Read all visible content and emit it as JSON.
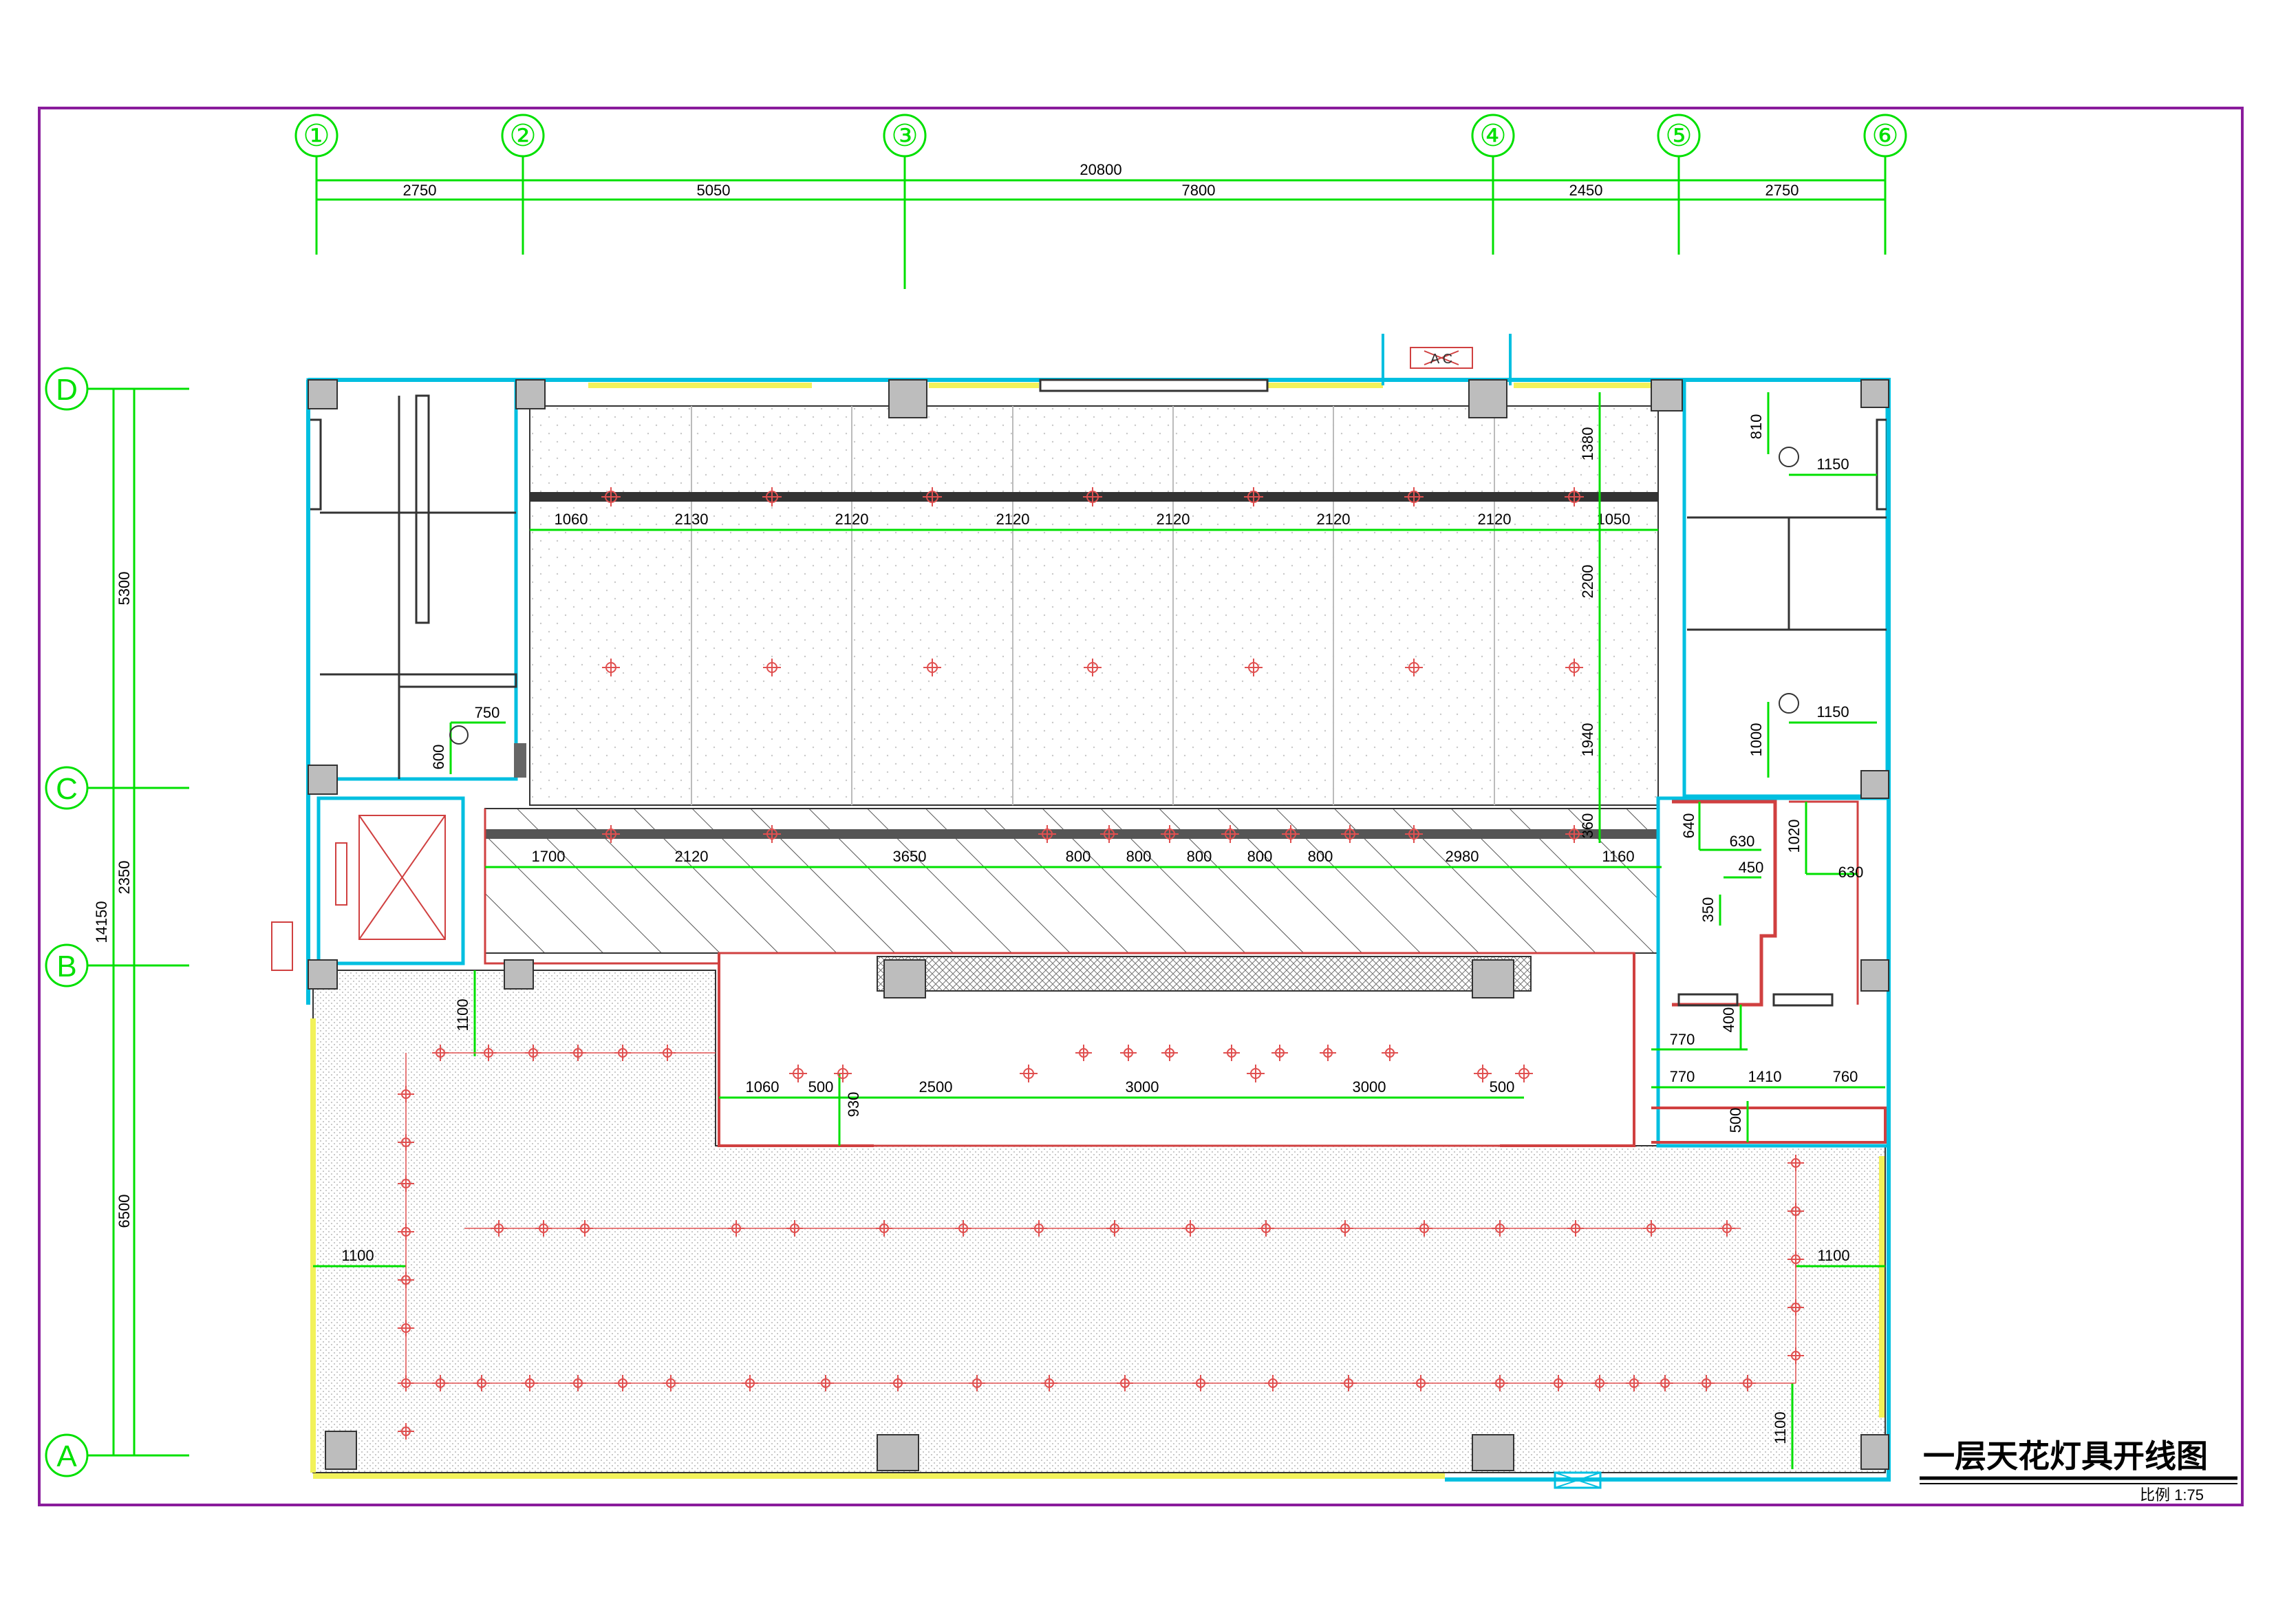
{
  "title": "一层天花灯具开线图",
  "scale": "比例 1:75",
  "colors": {
    "frame": "#8a1c9c",
    "dim": "#00e000",
    "wall": "#00bfe0",
    "fixture": "#e05050",
    "column": "#bdbdbd",
    "window": "#f2f25a",
    "dark": "#333333",
    "hatch": "#555555",
    "dot": "#cccccc",
    "text": "#000000"
  },
  "axes": {
    "top": [
      {
        "label": "①"
      },
      {
        "label": "②"
      },
      {
        "label": "③"
      },
      {
        "label": "④"
      },
      {
        "label": "⑤"
      },
      {
        "label": "⑥"
      }
    ],
    "left": [
      {
        "label": "D"
      },
      {
        "label": "C"
      },
      {
        "label": "B"
      },
      {
        "label": "A"
      }
    ]
  },
  "dimensions": {
    "top_total": "20800",
    "top_spans": [
      "2750",
      "5050",
      "7800",
      "2450",
      "2750"
    ],
    "left_total": "14150",
    "left_spans": [
      "5300",
      "2350",
      "6500"
    ],
    "upper_track": [
      "1060",
      "2130",
      "2120",
      "2120",
      "2120",
      "2120",
      "2120",
      "1050"
    ],
    "middle_track": [
      "1700",
      "2120",
      "3650",
      "800",
      "800",
      "800",
      "800",
      "800",
      "2980",
      "1160"
    ],
    "lower_track": [
      "1060",
      "500",
      "2500",
      "3000",
      "3000",
      "500"
    ],
    "upper_right_vertical": [
      "1380",
      "2200",
      "1940",
      "360"
    ],
    "room_right": [
      "810",
      "1150",
      "1150",
      "1000"
    ],
    "small_room": [
      "640",
      "630",
      "450",
      "350",
      "1020",
      "630"
    ],
    "lower_right": [
      "400",
      "770",
      "770",
      "1410",
      "760",
      "500"
    ],
    "left_room": [
      "750",
      "600"
    ],
    "hall": [
      "1100",
      "930",
      "1100",
      "1100",
      "1100"
    ]
  },
  "door_label": "A C"
}
